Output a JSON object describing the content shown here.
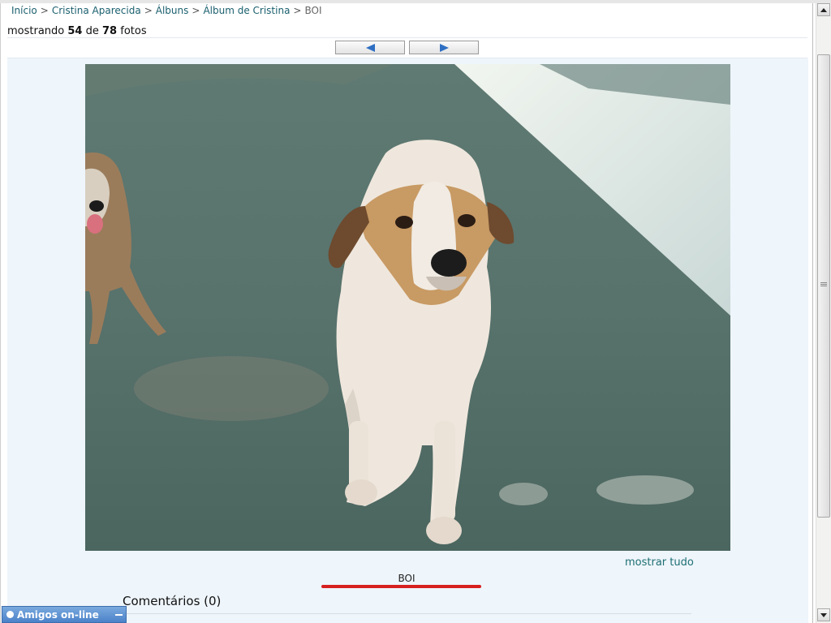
{
  "breadcrumb": {
    "items": [
      "Início",
      "Cristina Aparecida",
      "Álbuns",
      "Álbum de Cristina"
    ],
    "separator": ">",
    "current": "BOI"
  },
  "counter": {
    "prefix": "mostrando",
    "current": "54",
    "middle": "de",
    "total": "78",
    "suffix": "fotos"
  },
  "navigation": {
    "prev_icon": "left-arrow-icon",
    "next_icon": "right-arrow-icon"
  },
  "photo": {
    "alt": "BOI"
  },
  "show_all_label": "mostrar tudo",
  "caption": "BOI",
  "comments": {
    "title": "Comentários (0)"
  },
  "friends_bar": {
    "label": "Amigos on-line",
    "icon": "status-dot-icon"
  },
  "colors": {
    "link": "#1a5f6e",
    "panel_bg": "#eef5fb",
    "underline": "#d61f1f",
    "friends_bar": "#4b82c9",
    "arrow": "#2f6fc3"
  }
}
